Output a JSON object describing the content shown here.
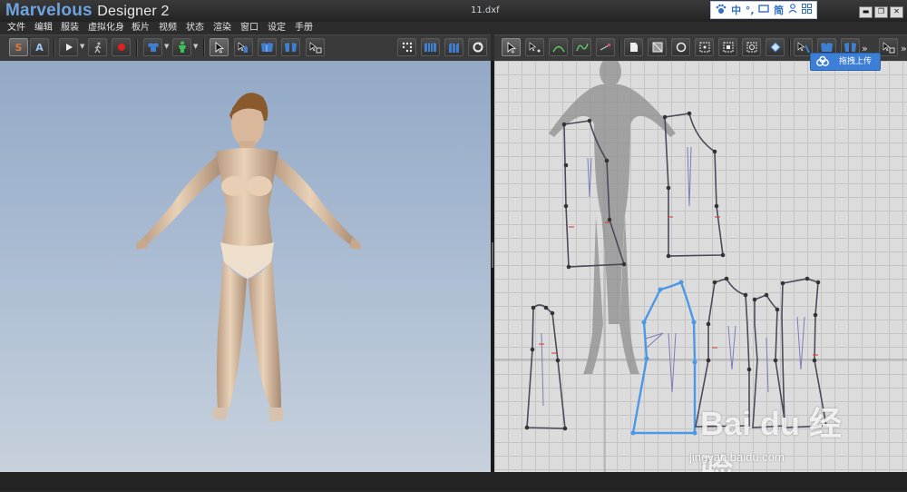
{
  "app": {
    "brand_name": "Marvelous",
    "brand_suffix": "Designer 2",
    "file_name": "11.dxf"
  },
  "ime": {
    "items": [
      "中",
      "°,",
      "简"
    ]
  },
  "menu": [
    "文件",
    "编辑",
    "服装",
    "虚拟化身",
    "板片",
    "视频",
    "状态",
    "渲染",
    "窗口",
    "设定",
    "手册"
  ],
  "toolbar_left": {
    "s_label": "S",
    "a_label": "A",
    "play_icon": "play-icon",
    "walk_icon": "walk-icon",
    "record_icon": "record-icon"
  },
  "tooltip": {
    "text": "拖拽上传"
  },
  "watermark": {
    "logo": "Bai du 经验",
    "url": "jingyan.baidu.com"
  },
  "colors": {
    "accent_blue": "#3d7fd6",
    "pattern_selected": "#4a98e6",
    "pattern_outline": "#4a4a5a",
    "viewport_3d_top": "#93a9c6",
    "viewport_2d": "#dcdcdc"
  }
}
